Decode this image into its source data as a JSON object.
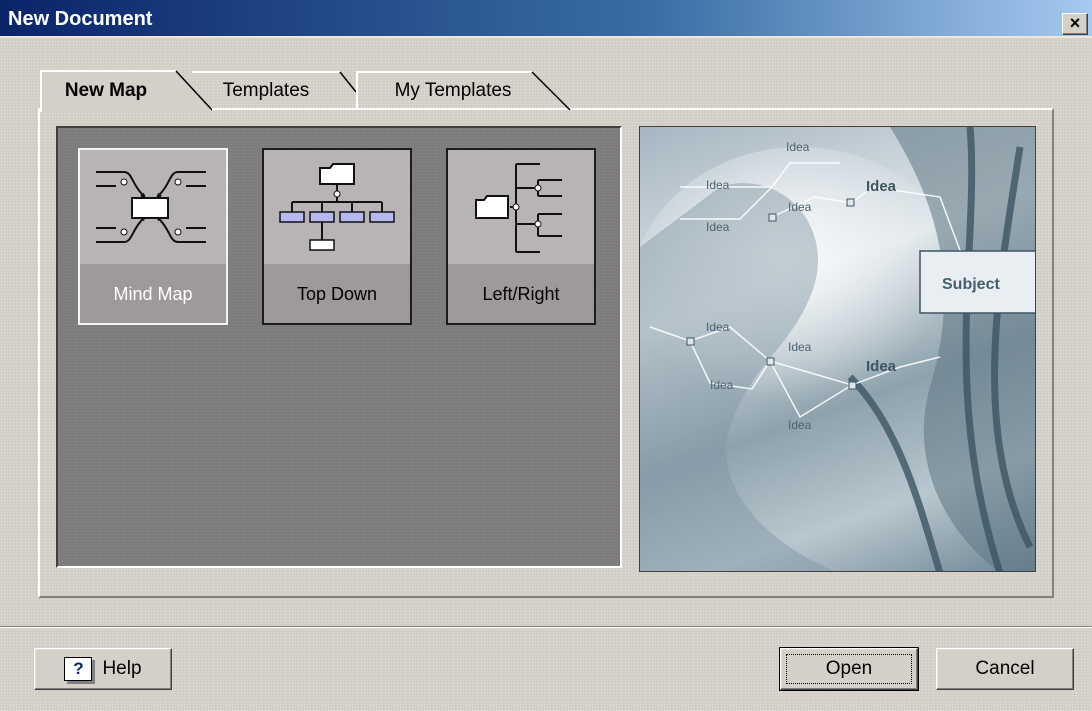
{
  "window": {
    "title": "New Document",
    "close_glyph": "×"
  },
  "tabs": [
    {
      "label": "New Map",
      "active": true
    },
    {
      "label": "Templates",
      "active": false
    },
    {
      "label": "My Templates",
      "active": false
    }
  ],
  "templates": [
    {
      "label": "Mind Map",
      "icon": "mind-map-icon",
      "selected": true
    },
    {
      "label": "Top Down",
      "icon": "top-down-icon",
      "selected": false
    },
    {
      "label": "Left/Right",
      "icon": "left-right-icon",
      "selected": false
    }
  ],
  "preview": {
    "central_label": "Subject",
    "idea_label": "Idea"
  },
  "buttons": {
    "help": "Help",
    "help_icon_glyph": "?",
    "open": "Open",
    "cancel": "Cancel"
  },
  "colors": {
    "titlebar_start": "#0a246a",
    "dialog_bg": "#d4d0c8",
    "tiles_pane_bg": "#7d7a7c",
    "connector_blue": "#b8b8f0"
  }
}
